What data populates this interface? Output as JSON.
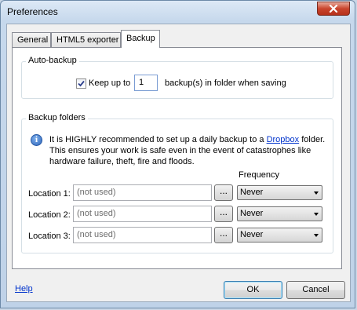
{
  "window": {
    "title": "Preferences",
    "close_icon": "close-icon"
  },
  "tabs": [
    {
      "label": "General",
      "active": false
    },
    {
      "label": "HTML5 exporter",
      "active": false
    },
    {
      "label": "Backup",
      "active": true
    }
  ],
  "auto_backup": {
    "group_label": "Auto-backup",
    "checked": true,
    "keep_label": "Keep up to",
    "count": "1",
    "suffix": "backup(s) in folder when saving"
  },
  "backup_folders": {
    "group_label": "Backup folders",
    "info_icon": "info-icon",
    "info_before_link": "It is HIGHLY recommended to set up a daily backup to a",
    "info_link": "Dropbox",
    "info_after_link": "folder.",
    "info_line2": "This ensures your work is safe even in the event of catastrophes like",
    "info_line3": "hardware failure, theft, fire and floods.",
    "frequency_header": "Frequency",
    "locations": [
      {
        "label": "Location 1:",
        "value": "(not used)",
        "browse": "...",
        "frequency": "Never"
      },
      {
        "label": "Location 2:",
        "value": "(not used)",
        "browse": "...",
        "frequency": "Never"
      },
      {
        "label": "Location 3:",
        "value": "(not used)",
        "browse": "...",
        "frequency": "Never"
      }
    ]
  },
  "footer": {
    "help_label": "Help",
    "ok_label": "OK",
    "cancel_label": "Cancel"
  }
}
